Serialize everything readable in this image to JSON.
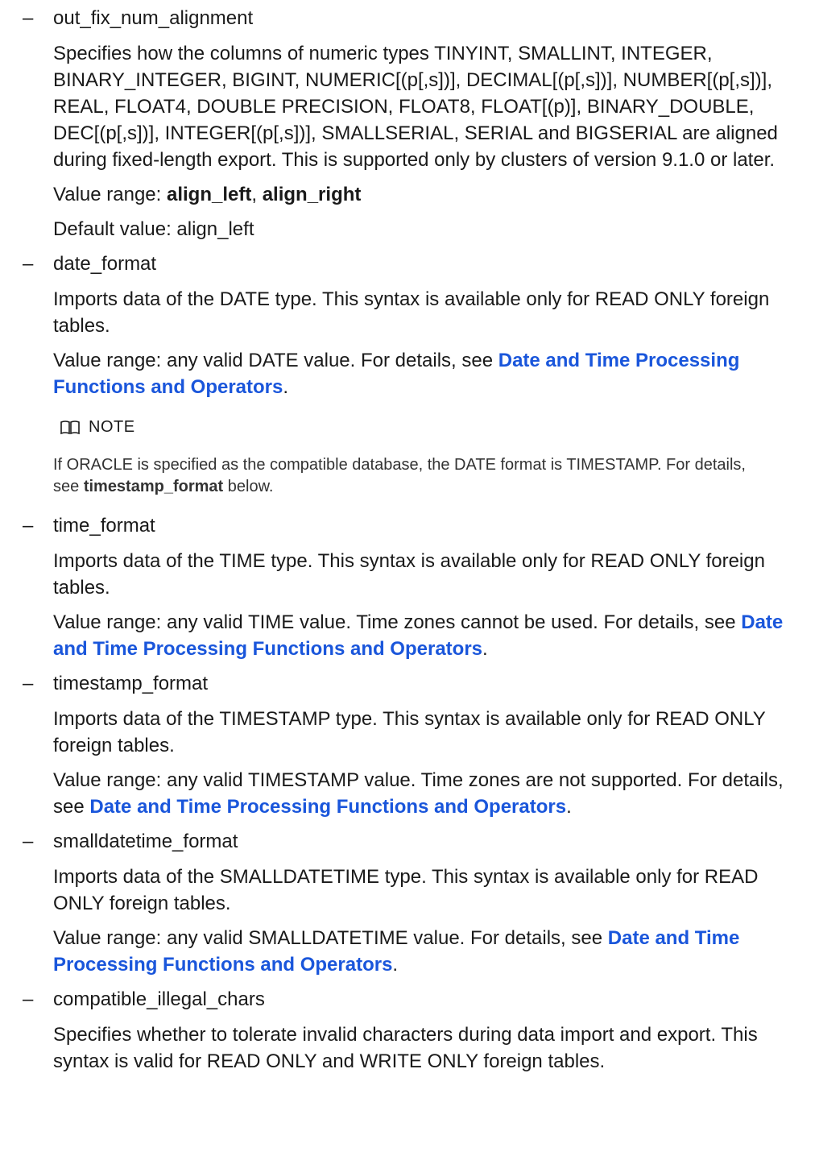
{
  "items": [
    {
      "name": "out_fix_num_alignment",
      "description": "Specifies how the columns of numeric types TINYINT, SMALLINT, INTEGER, BINARY_INTEGER, BIGINT, NUMERIC[(p[,s])], DECIMAL[(p[,s])], NUMBER[(p[,s])], REAL, FLOAT4, DOUBLE PRECISION, FLOAT8, FLOAT[(p)], BINARY_DOUBLE, DEC[(p[,s])], INTEGER[(p[,s])], SMALLSERIAL, SERIAL and BIGSERIAL are aligned during fixed-length export. This is supported only by clusters of version 9.1.0 or later.",
      "value_range_prefix": "Value range: ",
      "value_option_1": "align_left",
      "value_separator": ", ",
      "value_option_2": "align_right",
      "default_value": "Default value: align_left"
    },
    {
      "name": "date_format",
      "description": "Imports data of the DATE type. This syntax is available only for READ ONLY foreign tables.",
      "value_range_prefix": "Value range: any valid DATE value. For details, see ",
      "link_text": "Date and Time Processing Functions and Operators",
      "suffix": "."
    },
    {
      "name": "time_format",
      "description": "Imports data of the TIME type. This syntax is available only for READ ONLY foreign tables.",
      "value_range_prefix": "Value range: any valid TIME value. Time zones cannot be used. For details, see ",
      "link_text": "Date and Time Processing Functions and Operators",
      "suffix": "."
    },
    {
      "name": "timestamp_format",
      "description": "Imports data of the TIMESTAMP type. This syntax is available only for READ ONLY foreign tables.",
      "value_range_prefix": "Value range: any valid TIMESTAMP value. Time zones are not supported. For details, see ",
      "link_text": "Date and Time Processing Functions and Operators",
      "suffix": "."
    },
    {
      "name": "smalldatetime_format",
      "description": "Imports data of the SMALLDATETIME type. This syntax is available only for READ ONLY foreign tables.",
      "value_range_prefix": "Value range: any valid SMALLDATETIME value. For details, see ",
      "link_text": "Date and Time Processing Functions and Operators",
      "suffix": "."
    },
    {
      "name": "compatible_illegal_chars",
      "description": "Specifies whether to tolerate invalid characters during data import and export. This syntax is valid for READ ONLY and WRITE ONLY foreign tables."
    }
  ],
  "dash": "–",
  "note": {
    "label": "NOTE",
    "icon": "book-icon",
    "text_prefix": "If ORACLE is specified as the compatible database, the DATE format is TIMESTAMP. For details, see ",
    "text_bold": "timestamp_format",
    "text_suffix": " below."
  }
}
